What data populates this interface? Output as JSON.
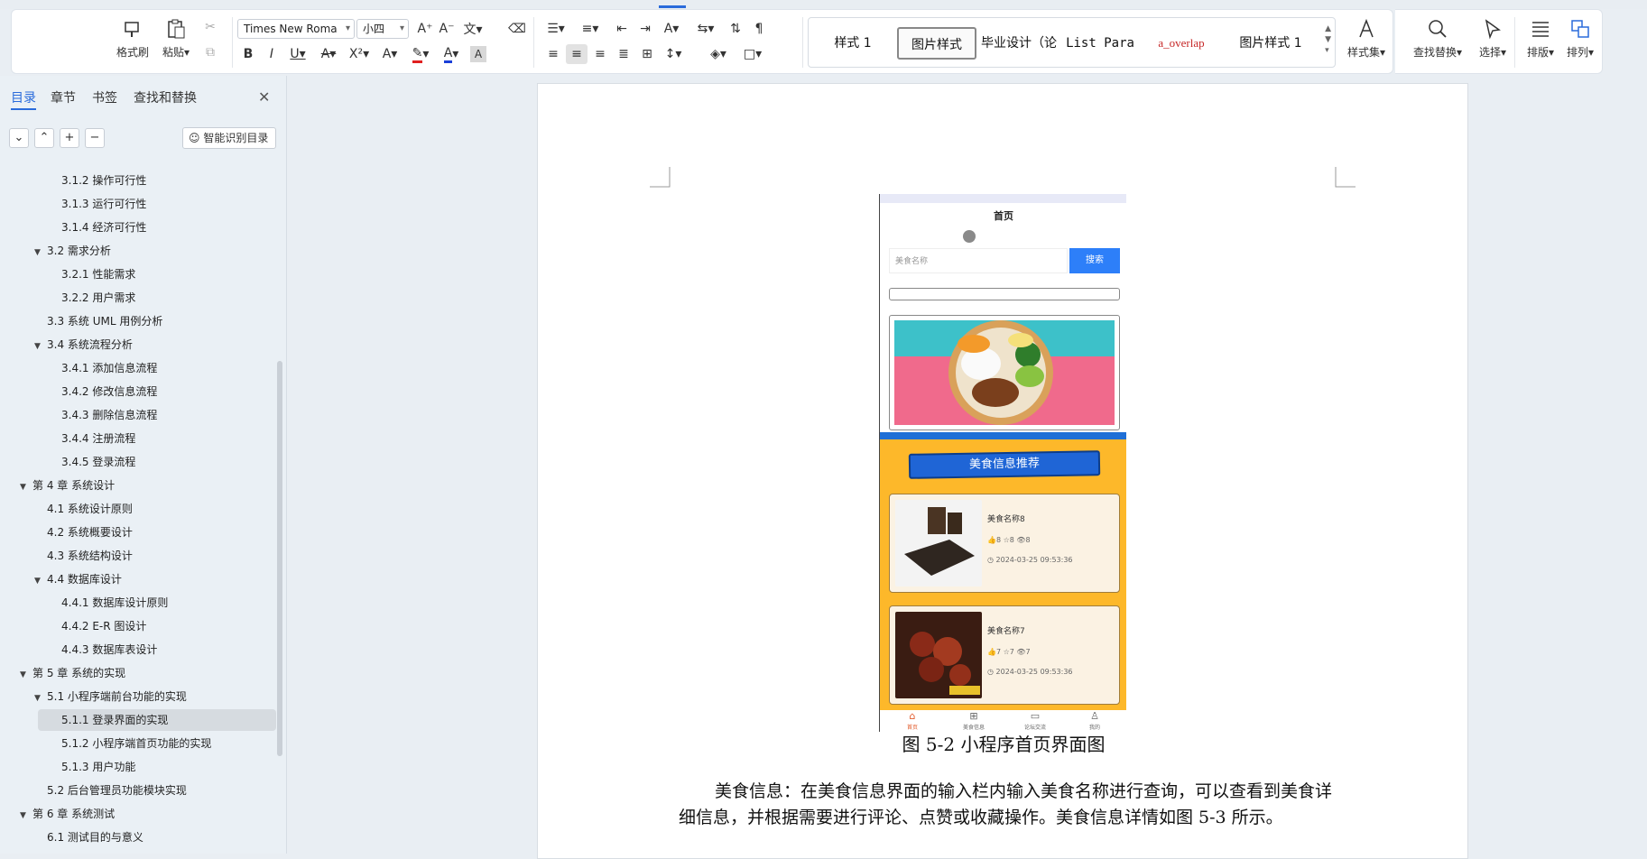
{
  "ribbon": {
    "format_painter": "格式刷",
    "paste": "粘贴",
    "font_name": "Times New Roma",
    "font_size": "小四",
    "styles": [
      "样式 1",
      "图片样式",
      "毕业设计（论",
      "List Para",
      "a_overlap",
      "图片样式 1"
    ],
    "style_set": "样式集",
    "find_replace": "查找替换",
    "select": "选择",
    "layout": "排版",
    "arrange": "排列",
    "accent_color": "#2a6bdb",
    "font_color": "#e02020",
    "highlight_color": "#1a3fd8"
  },
  "nav": {
    "tabs": [
      "目录",
      "章节",
      "书签",
      "查找和替换"
    ],
    "active_tab": "目录",
    "smart_toc": "智能识别目录",
    "items": [
      {
        "label": "3.1.2  操作可行性",
        "level": 3
      },
      {
        "label": "3.1.3  运行可行性",
        "level": 3
      },
      {
        "label": "3.1.4  经济可行性",
        "level": 3
      },
      {
        "label": "3.2  需求分析",
        "level": 2,
        "expand": "▼"
      },
      {
        "label": "3.2.1  性能需求",
        "level": 3
      },
      {
        "label": "3.2.2  用户需求",
        "level": 3
      },
      {
        "label": "3.3  系统 UML 用例分析",
        "level": 2
      },
      {
        "label": "3.4  系统流程分析",
        "level": 2,
        "expand": "▼"
      },
      {
        "label": "3.4.1  添加信息流程",
        "level": 3
      },
      {
        "label": "3.4.2  修改信息流程",
        "level": 3
      },
      {
        "label": "3.4.3  删除信息流程",
        "level": 3
      },
      {
        "label": "3.4.4  注册流程",
        "level": 3
      },
      {
        "label": "3.4.5  登录流程",
        "level": 3
      },
      {
        "label": "第 4 章  系统设计",
        "level": 1,
        "expand": "▼"
      },
      {
        "label": "4.1  系统设计原则",
        "level": 2
      },
      {
        "label": "4.2  系统概要设计",
        "level": 2
      },
      {
        "label": "4.3  系统结构设计",
        "level": 2
      },
      {
        "label": "4.4  数据库设计",
        "level": 2,
        "expand": "▼"
      },
      {
        "label": "4.4.1  数据库设计原则",
        "level": 3
      },
      {
        "label": "4.4.2   E-R 图设计",
        "level": 3
      },
      {
        "label": "4.4.3  数据库表设计",
        "level": 3
      },
      {
        "label": "第 5 章  系统的实现",
        "level": 1,
        "expand": "▼"
      },
      {
        "label": "5.1  小程序端前台功能的实现",
        "level": 2,
        "expand": "▼"
      },
      {
        "label": "5.1.1  登录界面的实现",
        "level": 3,
        "active": true
      },
      {
        "label": "5.1.2  小程序端首页功能的实现",
        "level": 3
      },
      {
        "label": "5.1.3  用户功能",
        "level": 3
      },
      {
        "label": "5.2  后台管理员功能模块实现",
        "level": 2
      },
      {
        "label": "第 6 章  系统测试",
        "level": 1,
        "expand": "▼"
      },
      {
        "label": "6.1  测试目的与意义",
        "level": 2
      }
    ]
  },
  "document": {
    "phone": {
      "title": "首页",
      "search_placeholder": "美食名称",
      "search_button": "搜索",
      "section_title": "美食信息推荐",
      "cards": [
        {
          "name": "美食名称8",
          "stats": "👍8  ☆8  👁8",
          "time": "2024-03-25 09:53:36"
        },
        {
          "name": "美食名称7",
          "stats": "👍7  ☆7  👁7",
          "time": "2024-03-25 09:53:36"
        }
      ],
      "tabbar": [
        "首页",
        "美食信息",
        "论坛交流",
        "我的"
      ]
    },
    "caption": "图 5-2 小程序首页界面图",
    "paragraph": "美食信息：在美食信息界面的输入栏内输入美食名称进行查询，可以查看到美食详细信息，并根据需要进行评论、点赞或收藏操作。美食信息详情如图 5-3 所示。"
  }
}
